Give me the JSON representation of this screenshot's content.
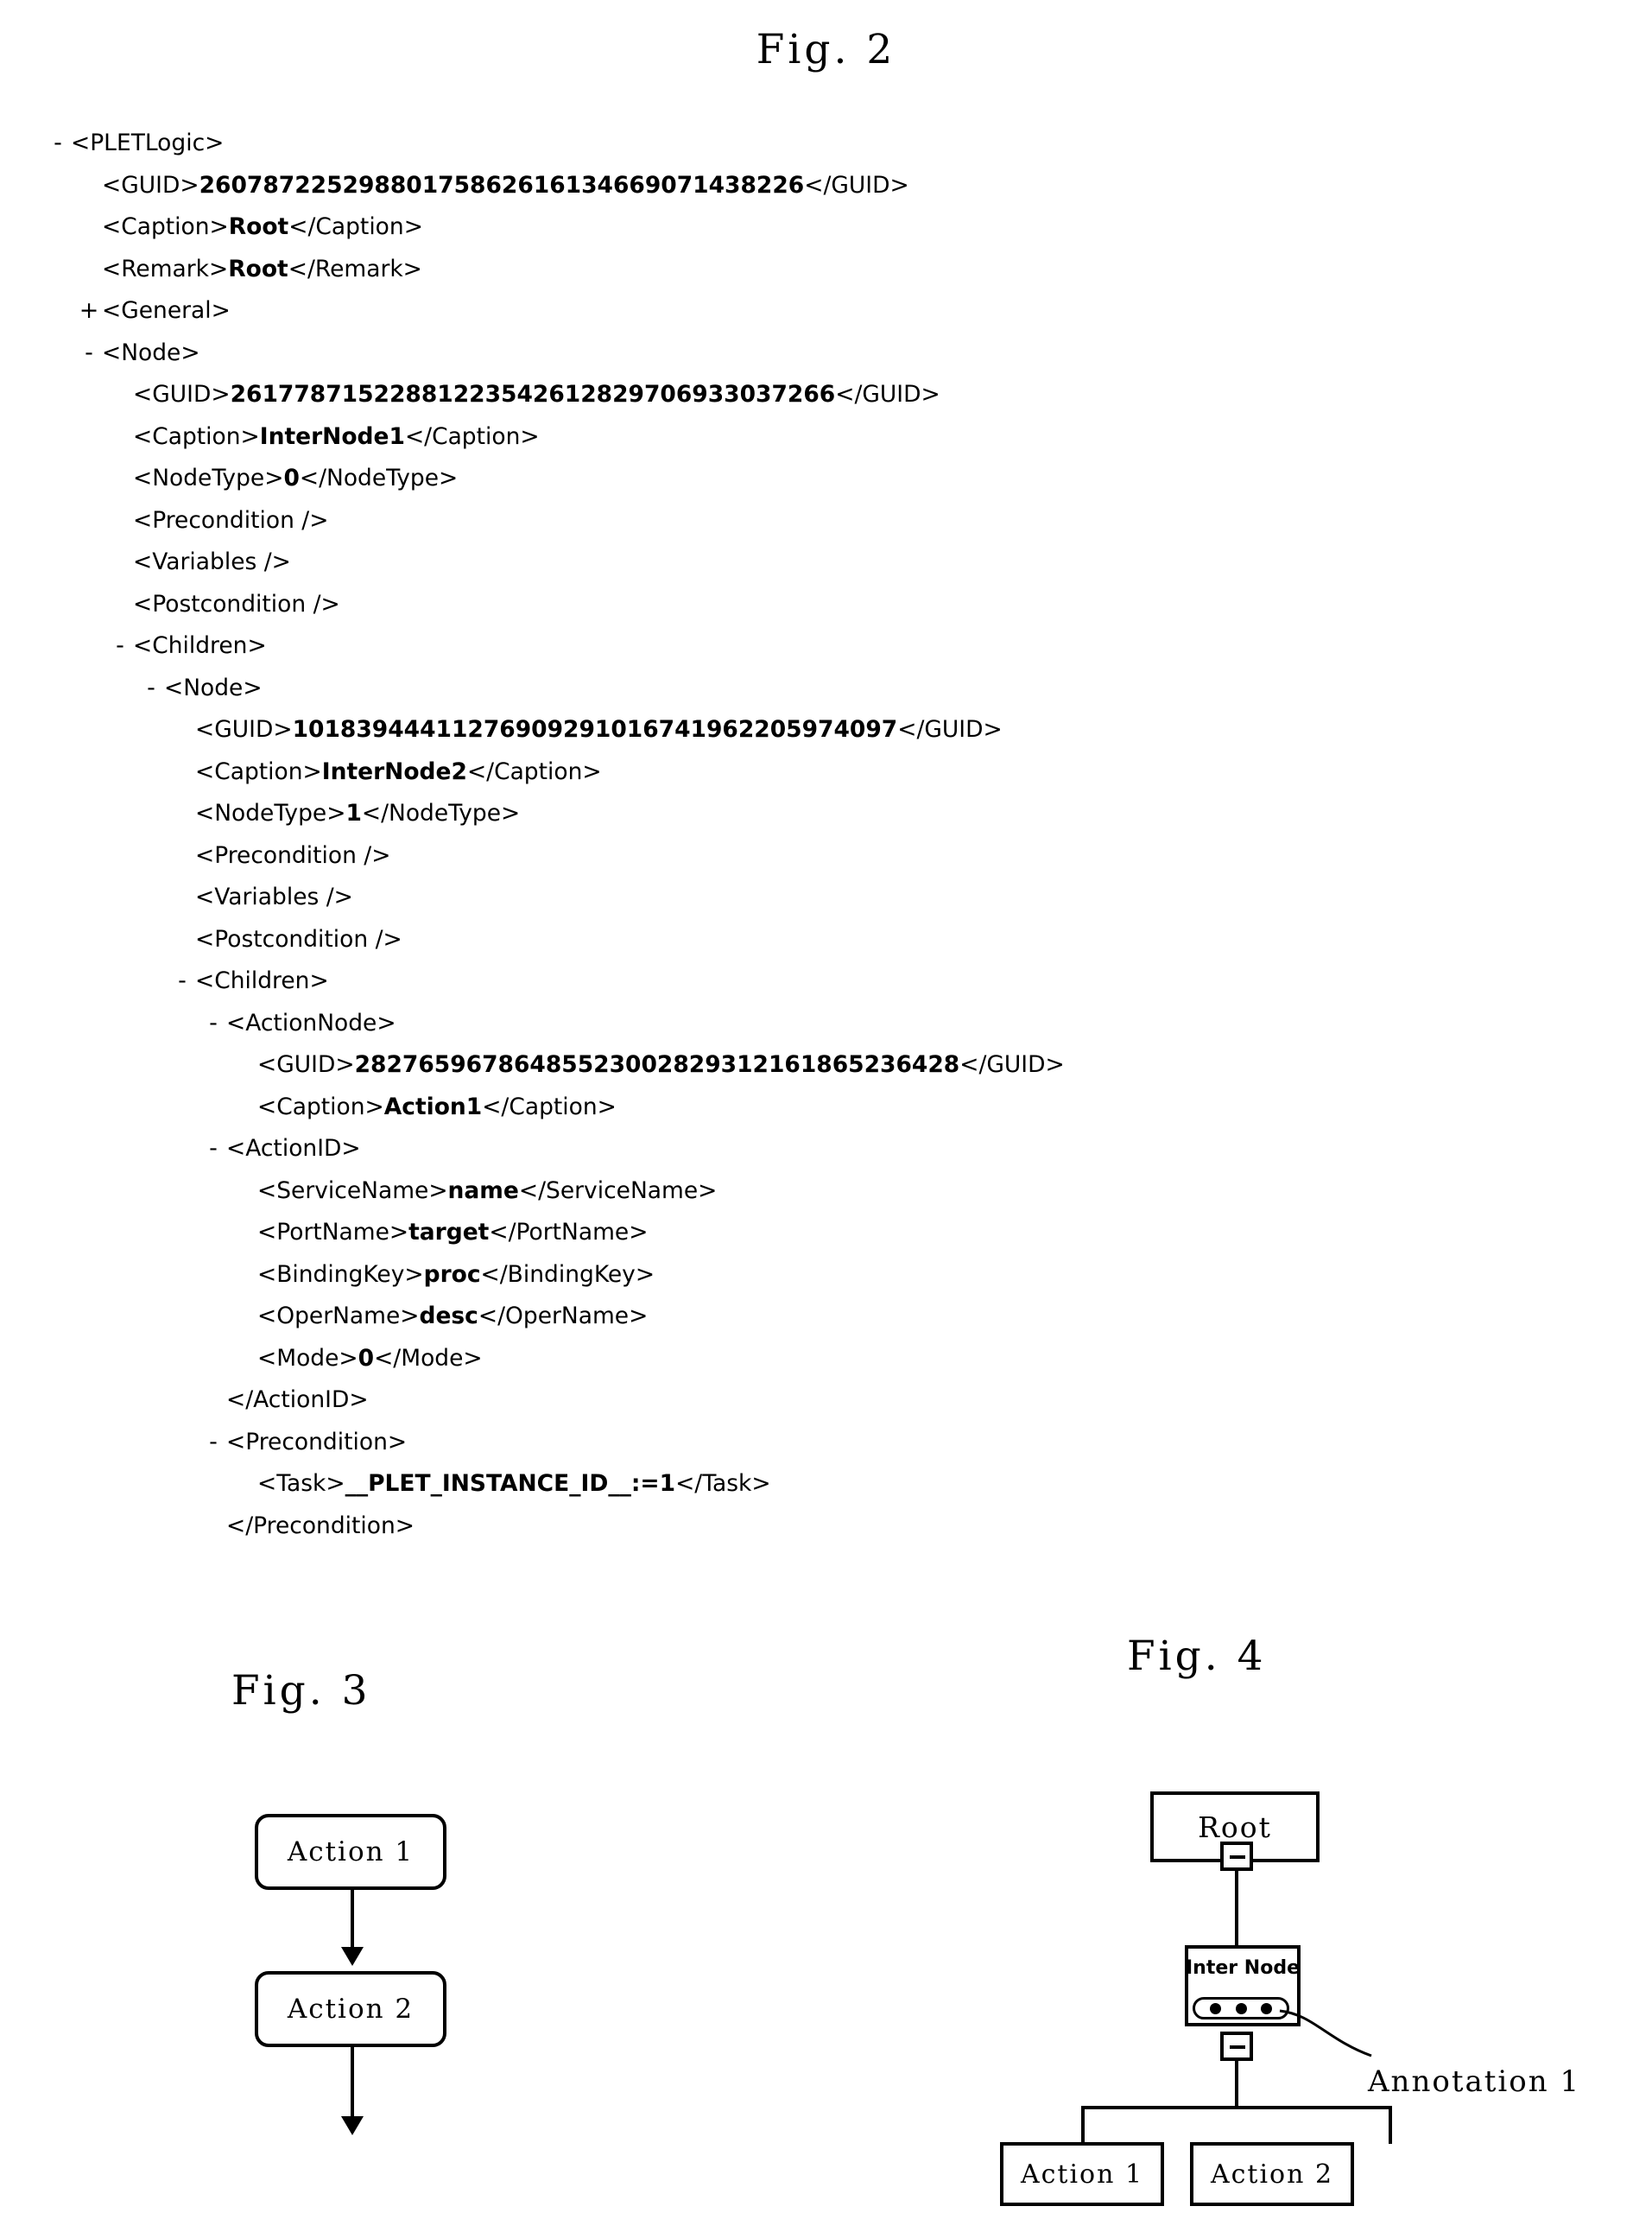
{
  "figures": {
    "fig2": {
      "caption": "Fig. 2"
    },
    "fig3": {
      "caption": "Fig. 3"
    },
    "fig4": {
      "caption": "Fig. 4"
    }
  },
  "xml_tree": {
    "lines": [
      {
        "toggle": "-",
        "indent": 0,
        "text": "<PLETLogic>"
      },
      {
        "toggle": "",
        "indent": 1,
        "pre": "<GUID>",
        "value": "26078722529880175862616134669071438226",
        "post": "</GUID>"
      },
      {
        "toggle": "",
        "indent": 1,
        "pre": "<Caption>",
        "value": "Root",
        "post": "</Caption>"
      },
      {
        "toggle": "",
        "indent": 1,
        "pre": "<Remark>",
        "value": "Root",
        "post": "</Remark>"
      },
      {
        "toggle": "+",
        "indent": 1,
        "text": "<General>"
      },
      {
        "toggle": "-",
        "indent": 1,
        "text": "<Node>"
      },
      {
        "toggle": "",
        "indent": 2,
        "pre": "<GUID>",
        "value": "26177871522881223542612829706933037266",
        "post": "</GUID>"
      },
      {
        "toggle": "",
        "indent": 2,
        "pre": "<Caption>",
        "value": "InterNode1",
        "post": "</Caption>"
      },
      {
        "toggle": "",
        "indent": 2,
        "pre": "<NodeType>",
        "value": "0",
        "post": "</NodeType>"
      },
      {
        "toggle": "",
        "indent": 2,
        "text": "<Precondition />"
      },
      {
        "toggle": "",
        "indent": 2,
        "text": "<Variables />"
      },
      {
        "toggle": "",
        "indent": 2,
        "text": "<Postcondition />"
      },
      {
        "toggle": "-",
        "indent": 2,
        "text": "<Children>"
      },
      {
        "toggle": "-",
        "indent": 3,
        "text": "<Node>"
      },
      {
        "toggle": "",
        "indent": 4,
        "pre": "<GUID>",
        "value": "10183944411276909291016741962205974097",
        "post": "</GUID>"
      },
      {
        "toggle": "",
        "indent": 4,
        "pre": "<Caption>",
        "value": "InterNode2",
        "post": "</Caption>"
      },
      {
        "toggle": "",
        "indent": 4,
        "pre": "<NodeType>",
        "value": "1",
        "post": "</NodeType>"
      },
      {
        "toggle": "",
        "indent": 4,
        "text": "<Precondition />"
      },
      {
        "toggle": "",
        "indent": 4,
        "text": "<Variables />"
      },
      {
        "toggle": "",
        "indent": 4,
        "text": "<Postcondition />"
      },
      {
        "toggle": "-",
        "indent": 4,
        "text": "<Children>"
      },
      {
        "toggle": "-",
        "indent": 5,
        "text": "<ActionNode>"
      },
      {
        "toggle": "",
        "indent": 6,
        "pre": "<GUID>",
        "value": "28276596786485523002829312161865236428",
        "post": "</GUID>"
      },
      {
        "toggle": "",
        "indent": 6,
        "pre": "<Caption>",
        "value": "Action1",
        "post": "</Caption>"
      },
      {
        "toggle": "-",
        "indent": 5,
        "text": "<ActionID>"
      },
      {
        "toggle": "",
        "indent": 6,
        "pre": "<ServiceName>",
        "value": "name",
        "post": "</ServiceName>"
      },
      {
        "toggle": "",
        "indent": 6,
        "pre": "<PortName>",
        "value": "target",
        "post": "</PortName>"
      },
      {
        "toggle": "",
        "indent": 6,
        "pre": "<BindingKey>",
        "value": "proc",
        "post": "</BindingKey>"
      },
      {
        "toggle": "",
        "indent": 6,
        "pre": "<OperName>",
        "value": "desc",
        "post": "</OperName>"
      },
      {
        "toggle": "",
        "indent": 6,
        "pre": "<Mode>",
        "value": "0",
        "post": "</Mode>"
      },
      {
        "toggle": "",
        "indent": 5,
        "text": "</ActionID>"
      },
      {
        "toggle": "-",
        "indent": 5,
        "text": "<Precondition>"
      },
      {
        "toggle": "",
        "indent": 6,
        "pre": "<Task>",
        "value": "__PLET_INSTANCE_ID__:=1",
        "post": "</Task>"
      },
      {
        "toggle": "",
        "indent": 5,
        "text": "</Precondition>"
      }
    ]
  },
  "fig3_diagram": {
    "nodes": [
      {
        "id": "action1",
        "label": "Action 1"
      },
      {
        "id": "action2",
        "label": "Action 2"
      }
    ],
    "edges": [
      {
        "from": "action1",
        "to": "action2"
      },
      {
        "from": "action2",
        "to": "out"
      }
    ]
  },
  "fig4_diagram": {
    "nodes": [
      {
        "id": "root",
        "label": "Root"
      },
      {
        "id": "internode",
        "label": "Inter Node"
      },
      {
        "id": "action1",
        "label": "Action 1"
      },
      {
        "id": "action2",
        "label": "Action 2"
      }
    ],
    "annotation": "Annotation 1",
    "handle_dots": 3,
    "edges": [
      {
        "from": "root",
        "to": "internode"
      },
      {
        "from": "internode",
        "to": "action1"
      },
      {
        "from": "internode",
        "to": "action2"
      }
    ]
  }
}
